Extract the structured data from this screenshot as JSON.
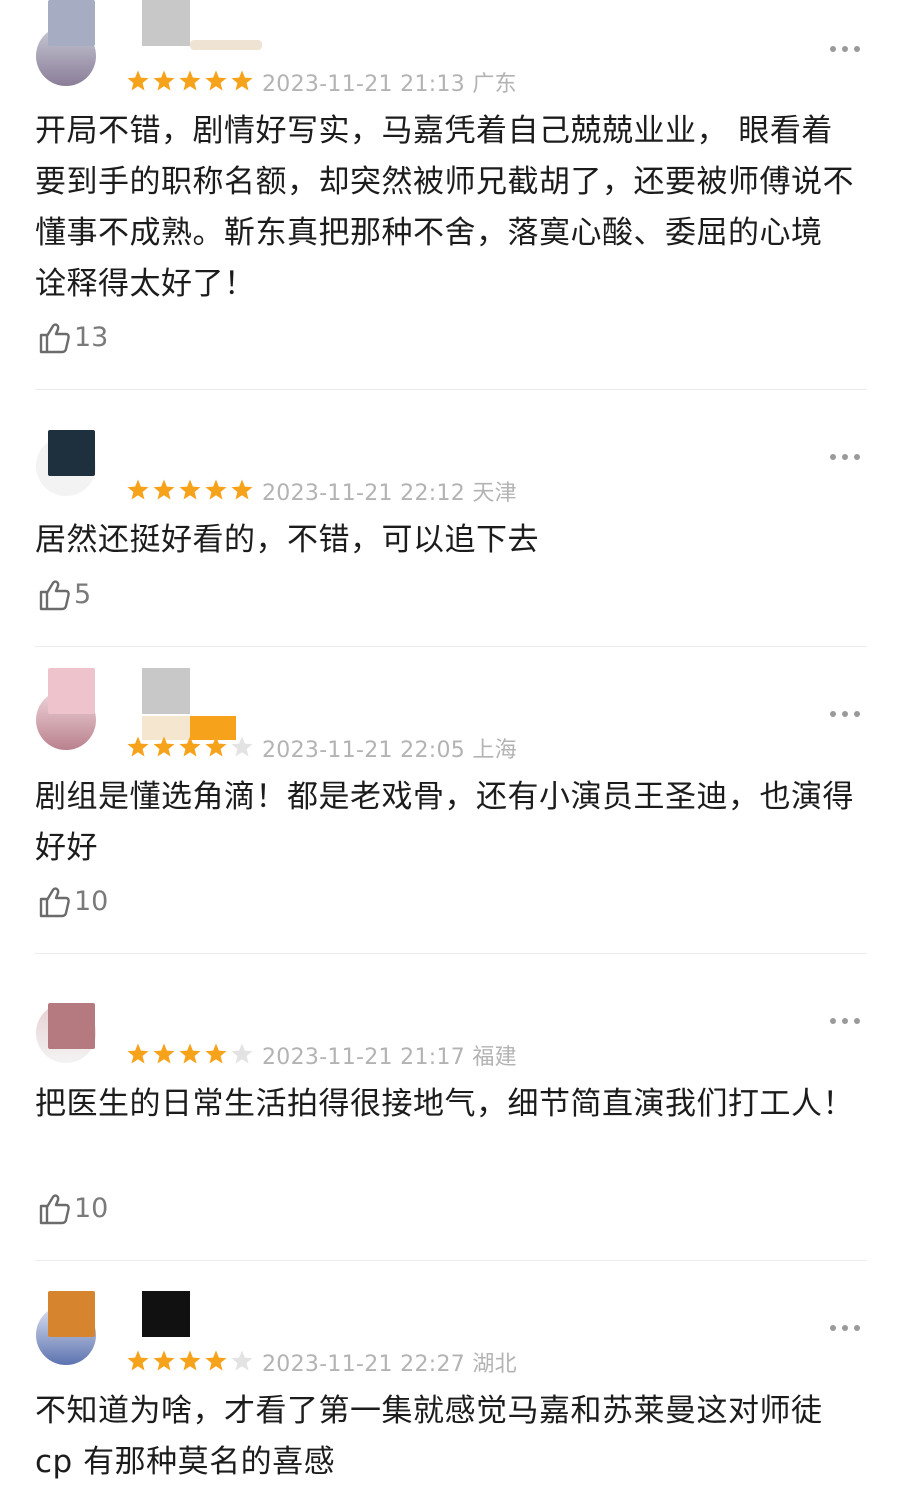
{
  "reviews": [
    {
      "rating": 5,
      "date": "2023-11-21 21:13",
      "location": "广东",
      "content": "开局不错，剧情好写实，马嘉凭着自己兢兢业业， 眼看着要到手的职称名额，却突然被师兄截胡了，还要被师傅说不懂事不成熟。靳东真把那种不舍，落寞心酸、委屈的心境 诠释得太好了！",
      "likes": "13",
      "avatar_colors": [
        "#a6adc2",
        "#8a7d98"
      ]
    },
    {
      "rating": 5,
      "date": "2023-11-21 22:12",
      "location": "天津",
      "content": "居然还挺好看的，不错，可以追下去",
      "likes": "5",
      "avatar_colors": [
        "#1e2f3d",
        "#1e2f3d"
      ]
    },
    {
      "rating": 4,
      "date": "2023-11-21 22:05",
      "location": "上海",
      "content": "剧组是懂选角滴！都是老戏骨，还有小演员王圣迪，也演得好好",
      "likes": "10",
      "avatar_colors": [
        "#efc3cc",
        "#b9818d"
      ]
    },
    {
      "rating": 4,
      "date": "2023-11-21 21:17",
      "location": "福建",
      "content": "把医生的日常生活拍得很接地气，细节简直演我们打工人！",
      "likes": "10",
      "avatar_colors": [
        "#b57a80",
        "#b57a80"
      ]
    },
    {
      "rating": 4,
      "date": "2023-11-21 22:27",
      "location": "湖北",
      "content": "不知道为啥，才看了第一集就感觉马嘉和苏莱曼这对师徒 cp 有那种莫名的喜感",
      "likes": "",
      "avatar_colors": [
        "#d6852e",
        "#5c73b0"
      ]
    }
  ],
  "colors": {
    "star_filled": "#f7a21b",
    "star_empty": "#e3e3e3",
    "meta": "#b3b3b3",
    "like": "#7a7a7a"
  },
  "icons": {
    "more": "more-dots-icon",
    "like": "thumbs-up-icon",
    "star": "star-icon"
  }
}
